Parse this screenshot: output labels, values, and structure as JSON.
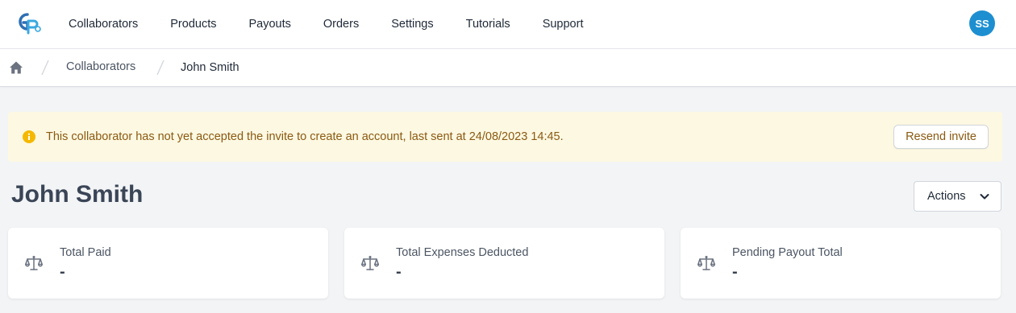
{
  "colors": {
    "accent": "#1d8fd1",
    "alert_background": "#fdf8e2",
    "alert_text": "#8a5a12",
    "alert_icon": "#f5b800",
    "page_background": "#f3f4f6"
  },
  "header": {
    "logo_icon": "gp-logo-icon",
    "nav": [
      {
        "label": "Collaborators"
      },
      {
        "label": "Products"
      },
      {
        "label": "Payouts"
      },
      {
        "label": "Orders"
      },
      {
        "label": "Settings"
      },
      {
        "label": "Tutorials"
      },
      {
        "label": "Support"
      }
    ],
    "avatar_initials": "SS"
  },
  "breadcrumb": {
    "home_icon": "home-icon",
    "items": [
      {
        "label": "Collaborators"
      },
      {
        "label": "John Smith"
      }
    ]
  },
  "alert": {
    "icon": "info-icon",
    "message": "This collaborator has not yet accepted the invite to create an account, last sent at 24/08/2023 14:45.",
    "button_label": "Resend invite"
  },
  "page": {
    "title": "John Smith",
    "actions_label": "Actions",
    "actions_icon": "chevron-down-icon"
  },
  "stats": [
    {
      "icon": "scale-icon",
      "label": "Total Paid",
      "value": "-"
    },
    {
      "icon": "scale-icon",
      "label": "Total Expenses Deducted",
      "value": "-"
    },
    {
      "icon": "scale-icon",
      "label": "Pending Payout Total",
      "value": "-"
    }
  ]
}
